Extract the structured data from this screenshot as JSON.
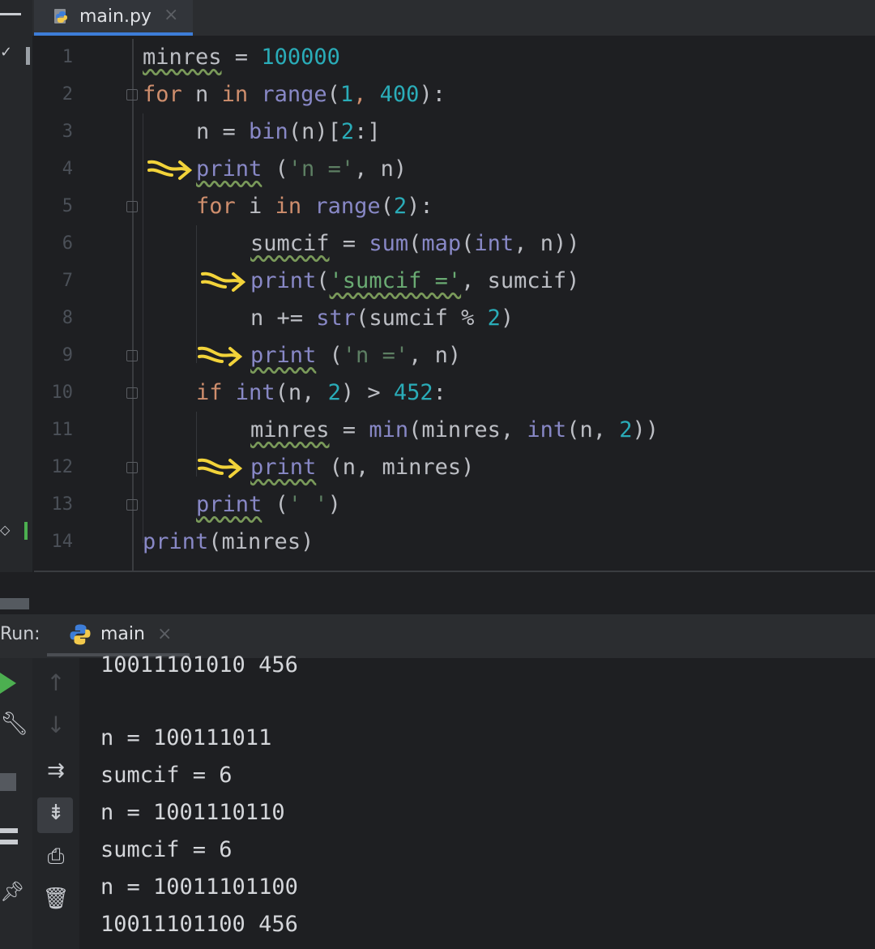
{
  "window": {
    "tab": {
      "label": "main.py",
      "close": "×"
    }
  },
  "editor": {
    "line_numbers": [
      "1",
      "2",
      "3",
      "4",
      "5",
      "6",
      "7",
      "8",
      "9",
      "10",
      "11",
      "12",
      "13",
      "14"
    ],
    "lines": {
      "l1": {
        "a": "minres",
        "b": " = ",
        "c": "100000"
      },
      "l2": {
        "a": "for",
        "b": " n ",
        "c": "in",
        "d": " ",
        "e": "range",
        "f": "(",
        "g": "1",
        "h": ", ",
        "i": "400",
        "j": "):"
      },
      "l3": {
        "a": "n = ",
        "b": "bin",
        "c": "(n)[",
        "d": "2",
        "e": ":]"
      },
      "l4": {
        "a": "print",
        "b": " (",
        "c": "'n ='",
        "d": ", n)"
      },
      "l5": {
        "a": "for",
        "b": " i ",
        "c": "in",
        "d": " ",
        "e": "range",
        "f": "(",
        "g": "2",
        "h": "):"
      },
      "l6": {
        "a": "sumcif",
        "b": " = ",
        "c": "sum",
        "d": "(",
        "e": "map",
        "f": "(",
        "g": "int",
        "h": ", n))"
      },
      "l7": {
        "a": "print",
        "b": "(",
        "c": "'sumcif ='",
        "d": ", sumcif)"
      },
      "l8": {
        "a": "n += ",
        "b": "str",
        "c": "(sumcif % ",
        "d": "2",
        "e": ")"
      },
      "l9": {
        "a": "print",
        "b": " (",
        "c": "'n ='",
        "d": ", n)"
      },
      "l10": {
        "a": "if",
        "b": " ",
        "c": "int",
        "d": "(n, ",
        "e": "2",
        "f": ") > ",
        "g": "452",
        "h": ":"
      },
      "l11": {
        "a": "minres",
        "b": " = ",
        "c": "min",
        "d": "(minres, ",
        "e": "int",
        "f": "(n, ",
        "g": "2",
        "h": "))"
      },
      "l12": {
        "a": "print",
        "b": " (n, minres)"
      },
      "l13": {
        "a": "print",
        "b": " (",
        "c": "' '",
        "d": ")"
      },
      "l14": {
        "a": "print",
        "b": "(minres)"
      }
    }
  },
  "run_panel": {
    "run_label": "Run:",
    "tab_label": "main",
    "tab_close": "×",
    "output": [
      "10011101010 456",
      "",
      "n = 100111011",
      "sumcif = 6",
      "n = 1001110110",
      "sumcif = 6",
      "n = 10011101100",
      "10011101100 456"
    ]
  },
  "colors": {
    "keyword": "#cf8e6d",
    "function": "#56a8f5",
    "builtin": "#8888c6",
    "number": "#2aacb8",
    "string": "#6aab73",
    "annotation_arrow": "#f2d33a",
    "run_green": "#4caf50"
  },
  "icons": {
    "run_tools": [
      "rerun-play-icon",
      "wrench-icon",
      "stop-icon",
      "layout-icon",
      "pin-icon",
      "up-arrow-icon",
      "down-arrow-icon",
      "soft-wrap-icon",
      "scroll-to-end-icon",
      "print-icon",
      "trash-icon"
    ]
  }
}
